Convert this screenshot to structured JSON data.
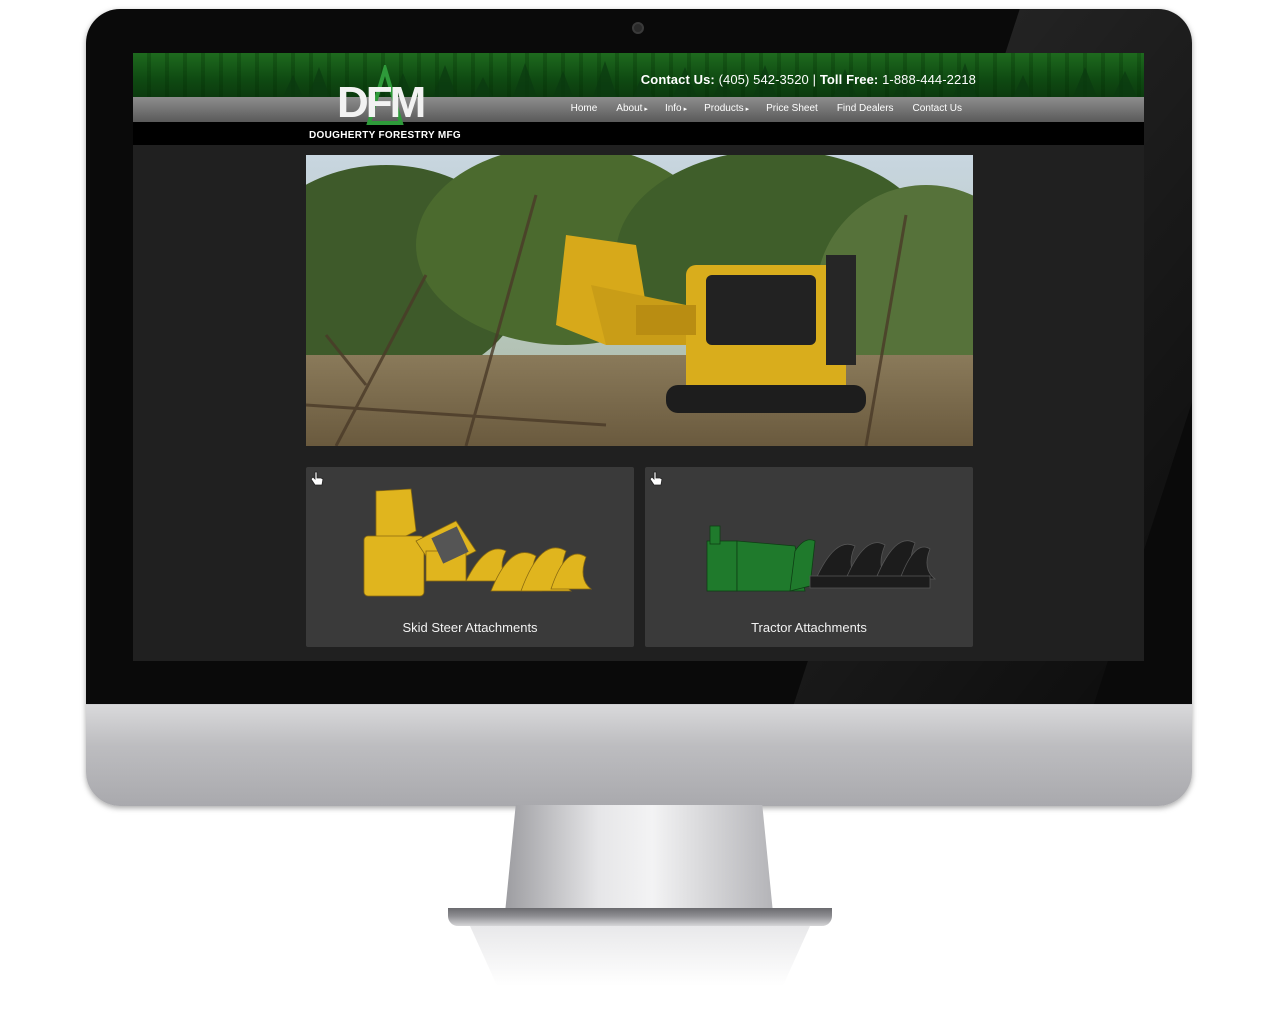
{
  "site": {
    "logo": {
      "letters": "DFM",
      "name": "DOUGHERTY FORESTRY MFG"
    },
    "contact": {
      "label": "Contact Us:",
      "phone": "(405) 542-3520",
      "separator": "|",
      "tollfree_label": "Toll Free:",
      "tollfree": "1-888-444-2218"
    },
    "nav": [
      {
        "label": "Home",
        "arrow": ""
      },
      {
        "label": "About",
        "arrow": "▸"
      },
      {
        "label": "Info",
        "arrow": "▸"
      },
      {
        "label": "Products",
        "arrow": "▸"
      },
      {
        "label": "Price Sheet",
        "arrow": ""
      },
      {
        "label": "Find Dealers",
        "arrow": ""
      },
      {
        "label": "Contact Us",
        "arrow": ""
      }
    ],
    "cards": [
      {
        "label": "Skid Steer Attachments"
      },
      {
        "label": "Tractor Attachments"
      }
    ],
    "colors": {
      "brand_green": "#1e6a1e",
      "attachment_yellow": "#e0b51e",
      "tractor_green": "#1f7a2c"
    },
    "icons": [
      "hand-pointer-icon",
      "logo-tree-icon"
    ]
  }
}
